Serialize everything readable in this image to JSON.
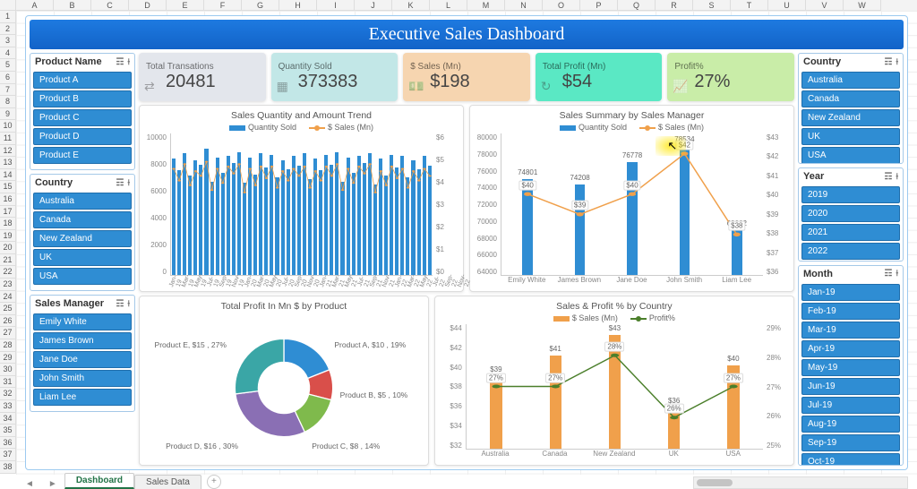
{
  "columns": [
    "A",
    "B",
    "C",
    "D",
    "E",
    "F",
    "G",
    "H",
    "I",
    "J",
    "K",
    "L",
    "M",
    "N",
    "O",
    "P",
    "Q",
    "R",
    "S",
    "T",
    "U",
    "V",
    "W"
  ],
  "row_count": 38,
  "tabs": {
    "active": "Dashboard",
    "others": [
      "Sales Data"
    ]
  },
  "title": "Executive Sales Dashboard",
  "slicers_left": [
    {
      "title": "Product Name",
      "items": [
        "Product A",
        "Product B",
        "Product C",
        "Product D",
        "Product E"
      ]
    },
    {
      "title": "Country",
      "items": [
        "Australia",
        "Canada",
        "New Zealand",
        "UK",
        "USA"
      ]
    },
    {
      "title": "Sales Manager",
      "items": [
        "Emily White",
        "James Brown",
        "Jane Doe",
        "John Smith",
        "Liam Lee"
      ]
    }
  ],
  "slicers_right": [
    {
      "title": "Country",
      "items": [
        "Australia",
        "Canada",
        "New Zealand",
        "UK",
        "USA"
      ]
    },
    {
      "title": "Year",
      "items": [
        "2019",
        "2020",
        "2021",
        "2022"
      ]
    },
    {
      "title": "Month",
      "items": [
        "Jan-19",
        "Feb-19",
        "Mar-19",
        "Apr-19",
        "May-19",
        "Jun-19",
        "Jul-19",
        "Aug-19",
        "Sep-19",
        "Oct-19"
      ]
    }
  ],
  "kpis": [
    {
      "label": "Total Transations",
      "value": "20481",
      "icon": "⇄"
    },
    {
      "label": "Quantity Sold",
      "value": "373383",
      "icon": "▦"
    },
    {
      "label": "$ Sales (Mn)",
      "value": "$198",
      "icon": "💵"
    },
    {
      "label": "Total Profit (Mn)",
      "value": "$54",
      "icon": "↻"
    },
    {
      "label": "Profit%",
      "value": "27%",
      "icon": "📈"
    }
  ],
  "chart_data": [
    {
      "id": "trend",
      "type": "bar+line",
      "title": "Sales Quantity and Amount Trend",
      "legend": [
        "Quantity Sold",
        "$ Sales (Mn)"
      ],
      "x": [
        "Jan-19",
        "Mar-19",
        "May-19",
        "Jul-19",
        "Sep-19",
        "Nov-19",
        "Jan-20",
        "Mar-20",
        "May-20",
        "Jul-20",
        "Sep-20",
        "Nov-20",
        "Jan-21",
        "Mar-21",
        "May-21",
        "Jul-21",
        "Sep-21",
        "Nov-21",
        "Jan-22",
        "Mar-22",
        "May-22",
        "Jul-22",
        "Sep-22",
        "Nov-22"
      ],
      "series": [
        {
          "name": "Quantity Sold",
          "axis": "left",
          "type": "bar",
          "color": "#2f8dd3",
          "values": [
            8200,
            7400,
            8600,
            7000,
            8100,
            7800,
            8900,
            6600,
            8300,
            7200,
            8400,
            7900,
            8700,
            6500,
            8300,
            7100,
            8600,
            7600,
            8500,
            6900,
            8100,
            7500,
            8400,
            7700,
            8600,
            6800,
            8200,
            7400,
            8500,
            7800,
            8700,
            6600,
            8300,
            7200,
            8400,
            7900,
            8600,
            6400,
            8200,
            7000,
            8500,
            7600,
            8400,
            6900,
            8100,
            7500,
            8400,
            7700
          ]
        },
        {
          "name": "$ Sales (Mn)",
          "axis": "right",
          "type": "line",
          "color": "#f0a04b",
          "values": [
            4.5,
            4.0,
            4.7,
            3.8,
            4.4,
            4.2,
            4.8,
            3.6,
            4.5,
            3.9,
            4.6,
            4.3,
            4.7,
            3.5,
            4.5,
            3.8,
            4.6,
            4.1,
            4.6,
            3.7,
            4.4,
            4.0,
            4.5,
            4.2,
            4.6,
            3.7,
            4.4,
            4.0,
            4.6,
            4.2,
            4.7,
            3.6,
            4.5,
            3.9,
            4.6,
            4.3,
            4.7,
            3.5,
            4.4,
            3.8,
            4.6,
            4.1,
            4.5,
            3.7,
            4.4,
            4.0,
            4.5,
            4.2
          ]
        }
      ],
      "yleft": {
        "ticks": [
          0,
          2000,
          4000,
          6000,
          8000,
          10000
        ],
        "range": [
          0,
          10000
        ]
      },
      "yright": {
        "ticks": [
          "$0",
          "$1",
          "$2",
          "$3",
          "$4",
          "$5",
          "$6"
        ],
        "range": [
          0,
          6
        ]
      }
    },
    {
      "id": "manager",
      "type": "bar+line",
      "title": "Sales Summary by Sales Manager",
      "legend": [
        "Quantity Sold",
        "$ Sales (Mn)"
      ],
      "x": [
        "Emily White",
        "James Brown",
        "Jane Doe",
        "John Smith",
        "Liam Lee"
      ],
      "series": [
        {
          "name": "Quantity Sold",
          "axis": "left",
          "type": "bar",
          "color": "#2f8dd3",
          "values": [
            74801,
            74208,
            76778,
            78534,
            69062
          ]
        },
        {
          "name": "$ Sales (Mn)",
          "axis": "right",
          "type": "line",
          "color": "#f0a04b",
          "values": [
            40,
            39,
            40,
            42,
            38
          ],
          "fmt": "$"
        }
      ],
      "yleft": {
        "ticks": [
          64000,
          66000,
          68000,
          70000,
          72000,
          74000,
          76000,
          78000,
          80000
        ],
        "range": [
          64000,
          80000
        ]
      },
      "yright": {
        "ticks": [
          "$36",
          "$37",
          "$38",
          "$39",
          "$40",
          "$41",
          "$42",
          "$43"
        ],
        "range": [
          36,
          43
        ]
      }
    },
    {
      "id": "donut",
      "type": "pie",
      "title": "Total Profit In Mn $ by Product",
      "slices": [
        {
          "name": "Product A",
          "value": 10,
          "pct": 19,
          "color": "#2f8dd3"
        },
        {
          "name": "Product B",
          "value": 5,
          "pct": 10,
          "color": "#d94f4a"
        },
        {
          "name": "Product C",
          "value": 8,
          "pct": 14,
          "color": "#7fba4c"
        },
        {
          "name": "Product D",
          "value": 16,
          "pct": 30,
          "color": "#8a6fb4"
        },
        {
          "name": "Product E",
          "value": 15,
          "pct": 27,
          "color": "#3aa6a6"
        }
      ]
    },
    {
      "id": "country",
      "type": "bar+line",
      "title": "Sales & Profit % by Country",
      "legend": [
        "$ Sales (Mn)",
        "Profit%"
      ],
      "x": [
        "Australia",
        "Canada",
        "New Zealand",
        "UK",
        "USA"
      ],
      "series": [
        {
          "name": "$ Sales (Mn)",
          "axis": "left",
          "type": "bar",
          "color": "#f0a04b",
          "values": [
            39,
            41,
            43,
            36,
            40
          ],
          "fmt": "$"
        },
        {
          "name": "Profit%",
          "axis": "right",
          "type": "line",
          "color": "#4b7f2b",
          "values": [
            27,
            27,
            28,
            26,
            27
          ],
          "fmt": "%"
        }
      ],
      "yleft": {
        "ticks": [
          "$32",
          "$34",
          "$36",
          "$38",
          "$40",
          "$42",
          "$44"
        ],
        "range": [
          32,
          44
        ]
      },
      "yright": {
        "ticks": [
          "25%",
          "26%",
          "27%",
          "28%",
          "29%"
        ],
        "range": [
          25,
          29
        ]
      }
    }
  ],
  "cursor": {
    "left_pct": 71,
    "top_pct": 27
  }
}
